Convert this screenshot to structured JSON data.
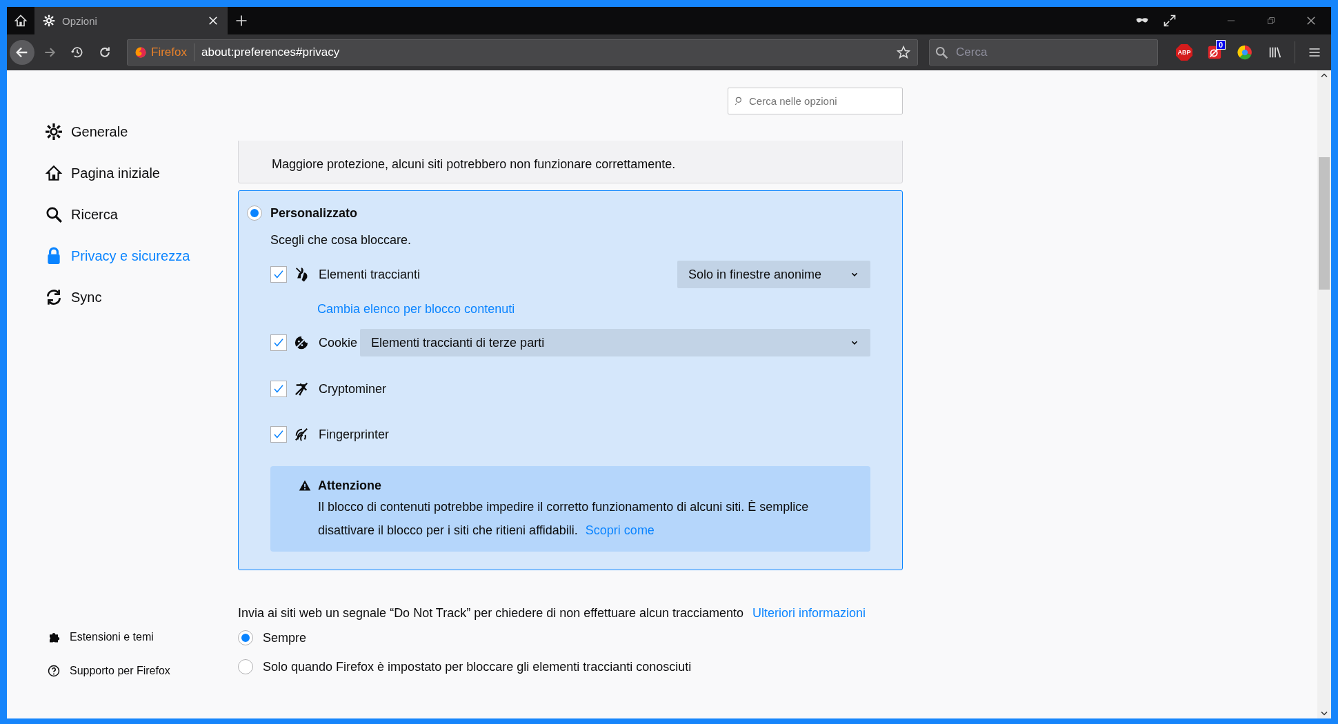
{
  "tabs": [
    {
      "title": "Opzioni",
      "selected": true
    }
  ],
  "url_bar": {
    "identity": "Firefox",
    "url": "about:preferences#privacy"
  },
  "web_search": {
    "placeholder": "Cerca"
  },
  "extensions": [
    {
      "kind": "abp",
      "label": "ABP"
    },
    {
      "kind": "badged",
      "badge": "0"
    },
    {
      "kind": "round"
    }
  ],
  "options_search": {
    "placeholder": "Cerca nelle opzioni"
  },
  "sidebar": {
    "items": [
      {
        "label": "Generale",
        "selected": false
      },
      {
        "label": "Pagina iniziale",
        "selected": false
      },
      {
        "label": "Ricerca",
        "selected": false
      },
      {
        "label": "Privacy e sicurezza",
        "selected": true
      },
      {
        "label": "Sync",
        "selected": false
      }
    ],
    "footer_items": [
      {
        "label": "Estensioni e temi"
      },
      {
        "label": "Supporto per Firefox"
      }
    ]
  },
  "blocking": {
    "cards": [
      {
        "kind": "partial",
        "selected": false,
        "description": "Maggiore protezione, alcuni siti potrebbero non funzionare correttamente."
      },
      {
        "kind": "custom",
        "selected": true,
        "title": "Personalizzato",
        "description": "Scegli che cosa bloccare.",
        "rows": [
          {
            "kind": "checkbox",
            "label": "Elementi traccianti",
            "checked": true,
            "dropdown": "Solo in finestre anonime"
          },
          {
            "kind": "link",
            "label": "Cambia elenco per blocco contenuti"
          },
          {
            "kind": "checkbox",
            "label": "Cookie",
            "checked": true,
            "dropdown": "Elementi traccianti di terze parti"
          },
          {
            "kind": "checkbox",
            "label": "Cryptominer",
            "checked": true
          },
          {
            "kind": "checkbox",
            "label": "Fingerprinter",
            "checked": true
          }
        ],
        "warning": {
          "title": "Attenzione",
          "text": "Il blocco di contenuti potrebbe impedire il corretto funzionamento di alcuni siti. È semplice disattivare il blocco per i siti che ritieni affidabili.",
          "link": "Scopri come"
        }
      }
    ]
  },
  "do_not_track": {
    "text": "Invia ai siti web un segnale “Do Not Track” per chiedere di non effettuare alcun tracciamento",
    "link": "Ulteriori informazioni",
    "options": [
      {
        "label": "Sempre",
        "selected": true
      },
      {
        "label": "Solo quando Firefox è impostato per bloccare gli elementi traccianti conosciuti",
        "selected": false
      }
    ]
  }
}
